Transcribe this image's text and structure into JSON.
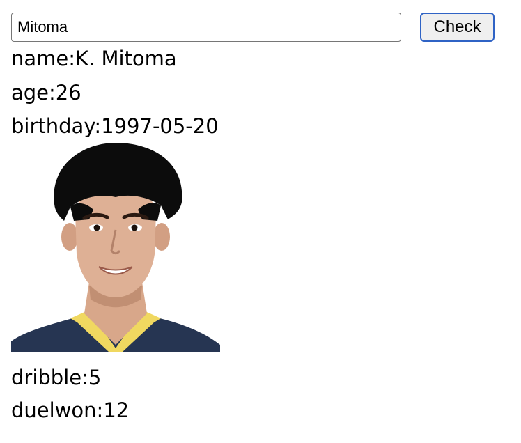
{
  "search": {
    "value": "Mitoma"
  },
  "check_button": {
    "label": "Check"
  },
  "player": {
    "name_label": "name:",
    "name": "K. Mitoma",
    "age_label": "age:",
    "age": "26",
    "birthday_label": "birthday:",
    "birthday": "1997-05-20",
    "dribble_label": "dribble:",
    "dribble": "5",
    "duelwon_label": "duelwon:",
    "duelwon": "12"
  },
  "colors": {
    "button_border": "#2f63c5",
    "button_background": "#efefef",
    "jersey_navy": "#263552",
    "jersey_collar": "#f0d860"
  }
}
